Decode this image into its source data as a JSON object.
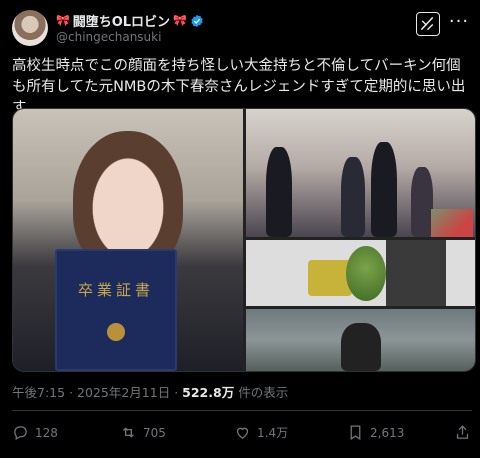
{
  "author": {
    "display_name": "闘堕ちOLロビン",
    "handle": "@chingechansuki",
    "bow_left": "🎀",
    "bow_right": "🎀"
  },
  "tweet": {
    "text": "高校生時点でこの顔面を持ち怪しい大金持ちと不倫してバーキン何個も所有してた元NMBの木下春奈さんレジェンドすぎて定期的に思い出す"
  },
  "media": {
    "diploma_text": "卒業証書"
  },
  "meta": {
    "time": "午後7:15",
    "separator": "·",
    "date": "2025年2月11日",
    "views_count": "522.8万",
    "views_label": "件の表示"
  },
  "actions": {
    "replies": "128",
    "retweets": "705",
    "likes": "1.4万",
    "bookmarks": "2,613"
  },
  "colors": {
    "background": "#000000",
    "text_primary": "#e7e9ea",
    "text_secondary": "#71767b",
    "verified": "#1d9bf0",
    "bow": "#e0245e"
  }
}
